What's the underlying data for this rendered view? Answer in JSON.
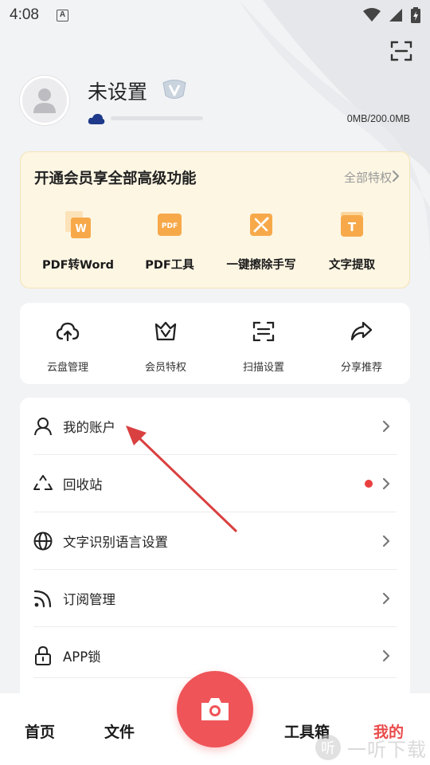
{
  "status_bar": {
    "time": "4:08",
    "a_label": "A"
  },
  "profile": {
    "name": "未设置",
    "storage": "0MB/200.0MB",
    "storage_fraction": 0
  },
  "vip_card": {
    "title": "开通会员享全部高级功能",
    "all_label": "全部特权",
    "features": [
      {
        "label": "PDF转Word",
        "icon": "pdf-to-word-icon",
        "badge": "W"
      },
      {
        "label": "PDF工具",
        "icon": "pdf-tools-icon",
        "badge": "PDF"
      },
      {
        "label": "一键擦除手写",
        "icon": "erase-handwriting-icon",
        "badge": ""
      },
      {
        "label": "文字提取",
        "icon": "text-extract-icon",
        "badge": "T"
      }
    ]
  },
  "quick_tools": [
    {
      "label": "云盘管理",
      "icon": "cloud-icon"
    },
    {
      "label": "会员特权",
      "icon": "vip-crown-icon"
    },
    {
      "label": "扫描设置",
      "icon": "scan-icon"
    },
    {
      "label": "分享推荐",
      "icon": "share-icon"
    }
  ],
  "settings": [
    {
      "label": "我的账户",
      "icon": "account-icon",
      "dot": false
    },
    {
      "label": "回收站",
      "icon": "recycle-icon",
      "dot": true
    },
    {
      "label": "文字识别语言设置",
      "icon": "globe-icon",
      "dot": false
    },
    {
      "label": "订阅管理",
      "icon": "rss-icon",
      "dot": false
    },
    {
      "label": "APP锁",
      "icon": "lock-icon",
      "dot": false
    }
  ],
  "bottom_nav": [
    {
      "label": "首页",
      "active": false
    },
    {
      "label": "文件",
      "active": false
    },
    {
      "label": "工具箱",
      "active": false
    },
    {
      "label": "我的",
      "active": true
    }
  ],
  "watermark": {
    "glyph": "听",
    "text": "一听下载"
  },
  "colors": {
    "accent": "#ef5458",
    "vip_bg": "#fdf6e3",
    "icon_orange": "#f7a94a",
    "annotation": "#d94040"
  }
}
